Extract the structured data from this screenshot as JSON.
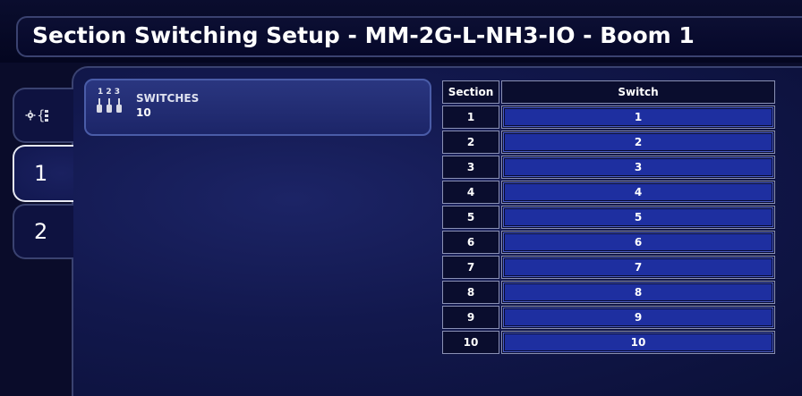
{
  "window": {
    "title": "Section Switching Setup - MM-2G-L-NH3-IO - Boom 1"
  },
  "tabs": [
    {
      "id": "settings",
      "icon": "settings-tab-icon"
    },
    {
      "id": "1",
      "label": "1",
      "active": true
    },
    {
      "id": "2",
      "label": "2",
      "active": false
    }
  ],
  "switches_card": {
    "icon": "switches-icon",
    "icon_digits": "1 2 3",
    "label": "SWITCHES",
    "value": "10"
  },
  "table": {
    "headers": {
      "section": "Section",
      "switch": "Switch"
    },
    "rows": [
      {
        "section": "1",
        "switch": "1"
      },
      {
        "section": "2",
        "switch": "2"
      },
      {
        "section": "3",
        "switch": "3"
      },
      {
        "section": "4",
        "switch": "4"
      },
      {
        "section": "5",
        "switch": "5"
      },
      {
        "section": "6",
        "switch": "6"
      },
      {
        "section": "7",
        "switch": "7"
      },
      {
        "section": "8",
        "switch": "8"
      },
      {
        "section": "9",
        "switch": "9"
      },
      {
        "section": "10",
        "switch": "10"
      }
    ]
  },
  "colors": {
    "background": "#0a0c2a",
    "panel": "#12184d",
    "switch_button": "#1e2fa0",
    "border": "#3a4270"
  }
}
